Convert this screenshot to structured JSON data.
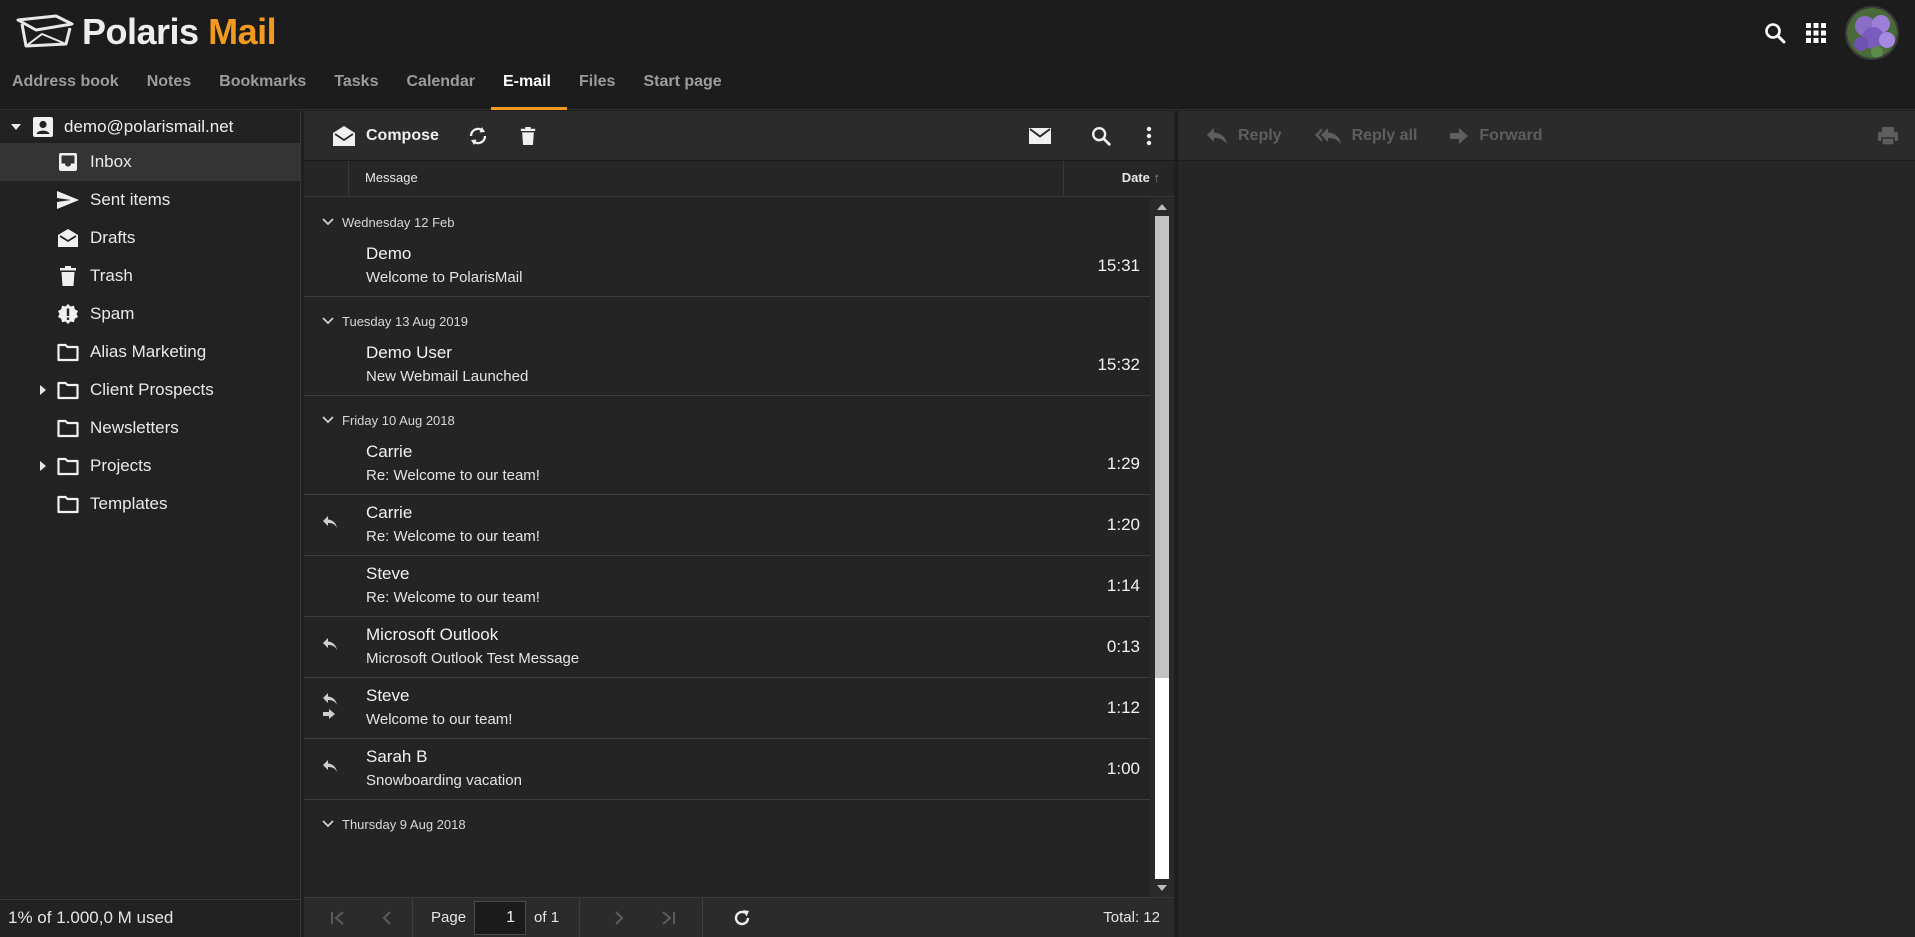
{
  "brand": {
    "word1": "Polaris",
    "word2": "Mail",
    "accent": "#f19a1f"
  },
  "nav": {
    "tabs": [
      {
        "label": "Address book"
      },
      {
        "label": "Notes"
      },
      {
        "label": "Bookmarks"
      },
      {
        "label": "Tasks"
      },
      {
        "label": "Calendar"
      },
      {
        "label": "E-mail"
      },
      {
        "label": "Files"
      },
      {
        "label": "Start page"
      }
    ],
    "active": "E-mail"
  },
  "sidebar": {
    "account": "demo@polarismail.net",
    "folders": [
      {
        "label": "Inbox",
        "icon": "inbox-icon"
      },
      {
        "label": "Sent items",
        "icon": "send-icon"
      },
      {
        "label": "Drafts",
        "icon": "drafts-icon"
      },
      {
        "label": "Trash",
        "icon": "trash-icon"
      },
      {
        "label": "Spam",
        "icon": "spam-icon"
      },
      {
        "label": "Alias Marketing",
        "icon": "folder-icon"
      },
      {
        "label": "Client Prospects",
        "icon": "folder-icon"
      },
      {
        "label": "Newsletters",
        "icon": "folder-icon"
      },
      {
        "label": "Projects",
        "icon": "folder-icon"
      },
      {
        "label": "Templates",
        "icon": "folder-icon"
      }
    ],
    "quota": "1% of 1.000,0 M used"
  },
  "toolbar": {
    "compose_label": "Compose"
  },
  "columns": {
    "message": "Message",
    "date": "Date"
  },
  "groups": [
    {
      "label": "Wednesday 12 Feb"
    },
    {
      "label": "Tuesday 13 Aug 2019"
    },
    {
      "label": "Friday 10 Aug 2018"
    },
    {
      "label": "Thursday 9 Aug 2018"
    }
  ],
  "messages": [
    {
      "from": "Demo",
      "subject": "Welcome to PolarisMail",
      "time": "15:31"
    },
    {
      "from": "Demo User",
      "subject": "New Webmail Launched",
      "time": "15:32"
    },
    {
      "from": "Carrie",
      "subject": "Re: Welcome to our team!",
      "time": "1:29"
    },
    {
      "from": "Carrie",
      "subject": "Re: Welcome to our team!",
      "time": "1:20"
    },
    {
      "from": "Steve",
      "subject": "Re: Welcome to our team!",
      "time": "1:14"
    },
    {
      "from": "Microsoft Outlook",
      "subject": "Microsoft Outlook Test Message",
      "time": "0:13"
    },
    {
      "from": "Steve",
      "subject": "Welcome to our team!",
      "time": "1:12"
    },
    {
      "from": "Sarah B",
      "subject": "Snowboarding vacation",
      "time": "1:00"
    }
  ],
  "pager": {
    "page_label": "Page",
    "page_value": "1",
    "of_label": "of 1",
    "total": "Total: 12"
  },
  "reading": {
    "reply": "Reply",
    "reply_all": "Reply all",
    "forward": "Forward"
  }
}
